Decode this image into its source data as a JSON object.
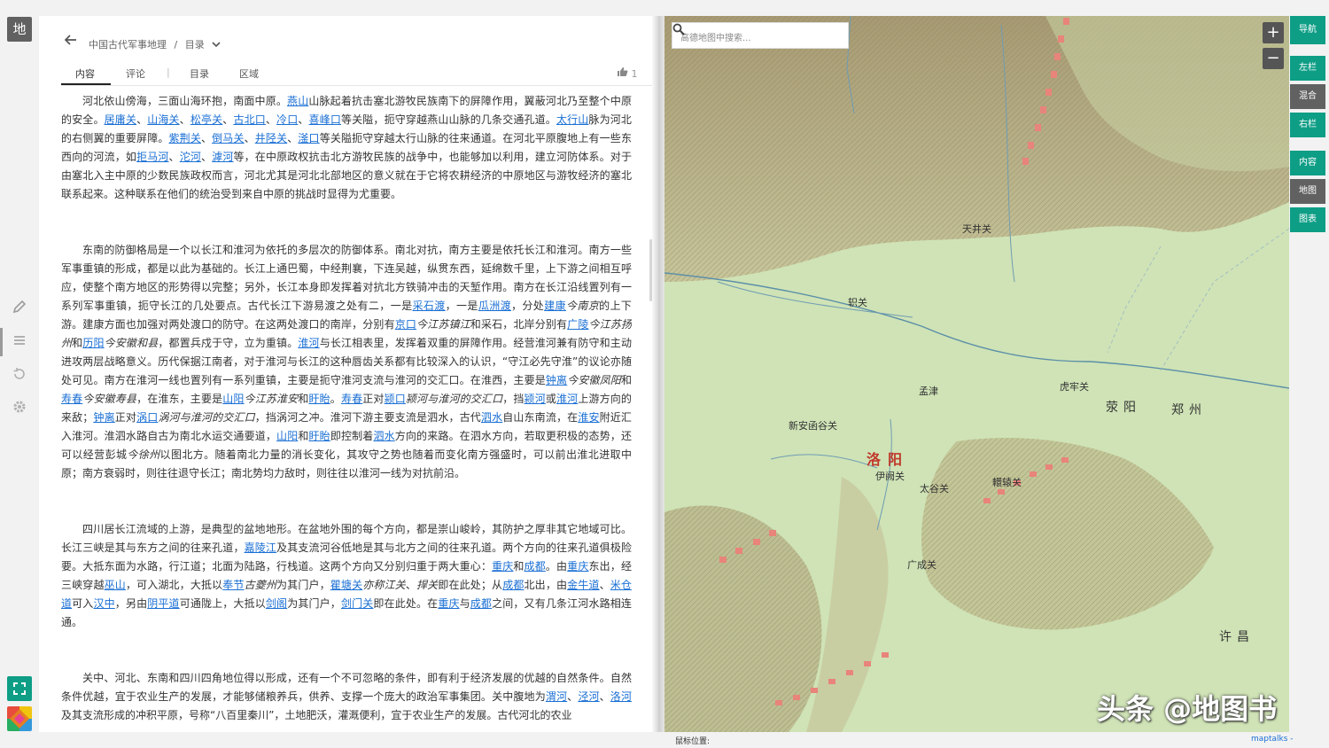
{
  "app": {
    "logo": "地"
  },
  "rail": {
    "icons": [
      "pencil-icon",
      "list-icon",
      "history-icon",
      "gear-icon"
    ],
    "bottom": [
      "fullscreen-icon",
      "colorful-app-icon"
    ]
  },
  "breadcrumb": {
    "title": "中国古代军事地理",
    "sep": "/",
    "section": "目录"
  },
  "tabs": [
    "内容",
    "评论",
    "|",
    "目录",
    "区域"
  ],
  "like_count": "1",
  "paragraphs": [
    [
      [
        "t",
        "河北依山傍海，三面山海环抱，南面中原。"
      ],
      [
        "a",
        "燕山"
      ],
      [
        "t",
        "山脉起着抗击塞北游牧民族南下的屏障作用，翼蔽河北乃至整个中原的安全。"
      ],
      [
        "a",
        "居庸关"
      ],
      [
        "t",
        "、"
      ],
      [
        "a",
        "山海关"
      ],
      [
        "t",
        "、"
      ],
      [
        "a",
        "松亭关"
      ],
      [
        "t",
        "、"
      ],
      [
        "a",
        "古北口"
      ],
      [
        "t",
        "、"
      ],
      [
        "a",
        "冷口"
      ],
      [
        "t",
        "、"
      ],
      [
        "a",
        "喜峰口"
      ],
      [
        "t",
        "等关隘，扼守穿越燕山山脉的几条交通孔道。"
      ],
      [
        "a",
        "太行山"
      ],
      [
        "t",
        "脉为河北的右侧翼的重要屏障。"
      ],
      [
        "a",
        "紫荆关"
      ],
      [
        "t",
        "、"
      ],
      [
        "a",
        "倒马关"
      ],
      [
        "t",
        "、"
      ],
      [
        "a",
        "井陉关"
      ],
      [
        "t",
        "、"
      ],
      [
        "a",
        "滏口"
      ],
      [
        "t",
        "等关隘扼守穿越太行山脉的往来通道。在河北平原腹地上有一些东西向的河流，如"
      ],
      [
        "a",
        "拒马河"
      ],
      [
        "t",
        "、"
      ],
      [
        "a",
        "沱河"
      ],
      [
        "t",
        "、"
      ],
      [
        "a",
        "滹河"
      ],
      [
        "t",
        "等，在中原政权抗击北方游牧民族的战争中，也能够加以利用，建立河防体系。对于由塞北入主中原的少数民族政权而言，河北尤其是河北北部地区的意义就在于它将农耕经济的中原地区与游牧经济的塞北联系起来。这种联系在他们的统治受到来自中原的挑战时显得为尤重要。"
      ]
    ],
    [
      [
        "t",
        "东南的防御格局是一个以长江和淮河为依托的多层次的防御体系。南北对抗，南方主要是依托长江和淮河。南方一些军事重镇的形成，都是以此为基础的。长江上通巴蜀，中经荆襄，下连吴越，纵贯东西，延绵数千里，上下游之间相互呼应，使整个南方地区的形势得以完整；另外，长江本身即发挥着对抗北方铁骑冲击的天堑作用。南方在长江沿线置列有一系列军事重镇，扼守长江的几处要点。古代长江下游易渡之处有二，一是"
      ],
      [
        "a",
        "采石渡"
      ],
      [
        "t",
        "，一是"
      ],
      [
        "a",
        "瓜洲渡"
      ],
      [
        "t",
        "，分处"
      ],
      [
        "a",
        "建康"
      ],
      [
        "i",
        "今南京"
      ],
      [
        "t",
        "的上下游。建康方面也加强对两处渡口的防守。在这两处渡口的南岸，分别有"
      ],
      [
        "a",
        "京口"
      ],
      [
        "i",
        "今江苏镇江"
      ],
      [
        "t",
        "和采石，北岸分别有"
      ],
      [
        "a",
        "广陵"
      ],
      [
        "i",
        "今江苏扬州"
      ],
      [
        "t",
        "和"
      ],
      [
        "a",
        "历阳"
      ],
      [
        "i",
        "今安徽和县"
      ],
      [
        "t",
        "，都置兵戍于守，立为重镇。"
      ],
      [
        "a",
        "淮河"
      ],
      [
        "t",
        "与长江相表里，发挥着双重的屏障作用。经营淮河兼有防守和主动进攻两层战略意义。历代保据江南者，对于淮河与长江的这种唇齿关系都有比较深入的认识，“守江必先守淮”的议论亦随处可见。南方在淮河一线也置列有一系列重镇，主要是扼守淮河支流与淮河的交汇口。在淮西，主要是"
      ],
      [
        "a",
        "钟离"
      ],
      [
        "i",
        "今安徽凤阳"
      ],
      [
        "t",
        "和"
      ],
      [
        "a",
        "寿春"
      ],
      [
        "i",
        "今安徽寿县"
      ],
      [
        "t",
        "，在淮东，主要是"
      ],
      [
        "a",
        "山阳"
      ],
      [
        "i",
        "今江苏淮安"
      ],
      [
        "t",
        "和"
      ],
      [
        "a",
        "盱眙"
      ],
      [
        "t",
        "。"
      ],
      [
        "a",
        "寿春"
      ],
      [
        "t",
        "正对"
      ],
      [
        "a",
        "颍口"
      ],
      [
        "i",
        "颍河与淮河的交汇口"
      ],
      [
        "t",
        "，挡"
      ],
      [
        "a",
        "颍河"
      ],
      [
        "t",
        "或"
      ],
      [
        "a",
        "淮河"
      ],
      [
        "t",
        "上游方向的来敌；"
      ],
      [
        "a",
        "钟离"
      ],
      [
        "t",
        "正对"
      ],
      [
        "a",
        "涡口"
      ],
      [
        "i",
        "涡河与淮河的交汇口"
      ],
      [
        "t",
        "，挡涡河之冲。淮河下游主要支流是泗水，古代"
      ],
      [
        "a",
        "泗水"
      ],
      [
        "t",
        "自山东南流，在"
      ],
      [
        "a",
        "淮安"
      ],
      [
        "t",
        "附近汇入淮河。淮泗水路自古为南北水运交通要道，"
      ],
      [
        "a",
        "山阳"
      ],
      [
        "t",
        "和"
      ],
      [
        "a",
        "盱眙"
      ],
      [
        "t",
        "即控制着"
      ],
      [
        "a",
        "泗水"
      ],
      [
        "t",
        "方向的来路。在泗水方向，若取更积极的态势，还可以经营彭城"
      ],
      [
        "i",
        "今徐州"
      ],
      [
        "t",
        "以图北方。随着南北力量的消长变化，其攻守之势也随着而变化南方强盛时，可以前出淮北进取中原；南方衰弱时，则往往退守长江；南北势均力敌时，则往往以淮河一线为对抗前沿。"
      ]
    ],
    [
      [
        "t",
        "四川居长江流域的上游，是典型的盆地地形。在盆地外围的每个方向，都是崇山峻岭，其防护之厚非其它地域可比。长江三峡是其与东方之间的往来孔道，"
      ],
      [
        "a",
        "嘉陵江"
      ],
      [
        "t",
        "及其支流河谷低地是其与北方之间的往来孔道。两个方向的往来孔道俱极险要。大抵东面为水路，行江道；北面为陆路，行栈道。这两个方向又分别归重于两大重心："
      ],
      [
        "a",
        "重庆"
      ],
      [
        "t",
        "和"
      ],
      [
        "a",
        "成都"
      ],
      [
        "t",
        "。由"
      ],
      [
        "a",
        "重庆"
      ],
      [
        "t",
        "东出，经三峡穿越"
      ],
      [
        "a",
        "巫山"
      ],
      [
        "t",
        "，可入湖北，大抵以"
      ],
      [
        "a",
        "奉节"
      ],
      [
        "i",
        "古夔州"
      ],
      [
        "t",
        "为其门户，"
      ],
      [
        "a",
        "瞿塘关"
      ],
      [
        "i",
        "亦称江关"
      ],
      [
        "t",
        "、"
      ],
      [
        "i",
        "捍关"
      ],
      [
        "t",
        "即在此处；从"
      ],
      [
        "a",
        "成都"
      ],
      [
        "t",
        "北出，由"
      ],
      [
        "a",
        "金牛道"
      ],
      [
        "t",
        "、"
      ],
      [
        "a",
        "米仓道"
      ],
      [
        "t",
        "可入"
      ],
      [
        "a",
        "汉中"
      ],
      [
        "t",
        "，另由"
      ],
      [
        "a",
        "阴平道"
      ],
      [
        "t",
        "可通陇上，大抵以"
      ],
      [
        "a",
        "剑阁"
      ],
      [
        "t",
        "为其门户，"
      ],
      [
        "a",
        "剑门关"
      ],
      [
        "t",
        "即在此处。在"
      ],
      [
        "a",
        "重庆"
      ],
      [
        "t",
        "与"
      ],
      [
        "a",
        "成都"
      ],
      [
        "t",
        "之间，又有几条江河水路相连通。"
      ]
    ],
    [
      [
        "t",
        "关中、河北、东南和四川四角地位得以形成，还有一个不可忽略的条件，即有利于经济发展的优越的自然条件。自然条件优越，宜于农业生产的发展，才能够储粮养兵，供养、支撑一个庞大的政治军事集团。关中腹地为"
      ],
      [
        "a",
        "渭河"
      ],
      [
        "t",
        "、"
      ],
      [
        "a",
        "泾河"
      ],
      [
        "t",
        "、"
      ],
      [
        "a",
        "洛河"
      ],
      [
        "t",
        "及其支流形成的冲积平原，号称“八百里秦川”，土地肥沃，灌溉便利，宜于农业生产的发展。古代河北的农业"
      ]
    ]
  ],
  "map": {
    "search_placeholder": "高德地图中搜索...",
    "zoom_in": "+",
    "zoom_out": "−",
    "places": [
      {
        "name": "天井关",
        "cls": ""
      },
      {
        "name": "轵关",
        "cls": ""
      },
      {
        "name": "孟津",
        "cls": ""
      },
      {
        "name": "虎牢关",
        "cls": ""
      },
      {
        "name": "荥阳",
        "cls": "big"
      },
      {
        "name": "郑州",
        "cls": "big"
      },
      {
        "name": "新安函谷关",
        "cls": ""
      },
      {
        "name": "洛阳",
        "cls": "city"
      },
      {
        "name": "伊阙关",
        "cls": ""
      },
      {
        "name": "太谷关",
        "cls": ""
      },
      {
        "name": "轘辕关",
        "cls": ""
      },
      {
        "name": "广成关",
        "cls": ""
      },
      {
        "name": "许昌",
        "cls": "big"
      }
    ],
    "watermark": "头条 @地图书"
  },
  "right_panel": {
    "group1": [
      "导航"
    ],
    "group2": [
      "左栏",
      "混合",
      "右栏"
    ],
    "group3": [
      "内容",
      "地图",
      "图表"
    ]
  },
  "footer": {
    "mouse_label": "鼠标位置:",
    "attribution": "maptalks -"
  },
  "colors": {
    "accent": "#0e9e86",
    "gray": "#616161",
    "link": "#1a6fd4",
    "capital": "#c0392b"
  }
}
